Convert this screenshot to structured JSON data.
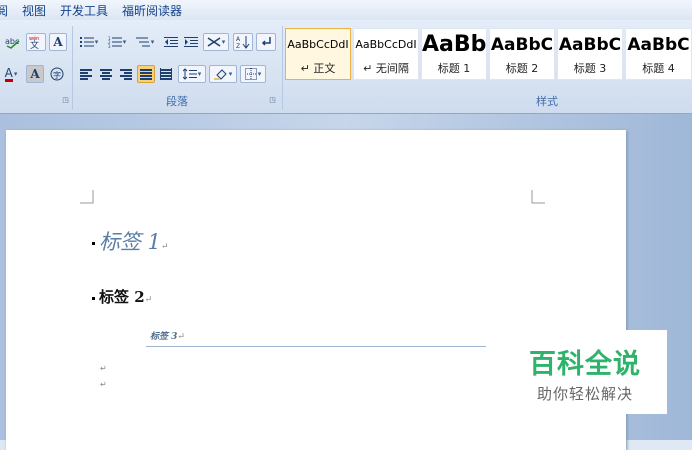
{
  "menu": {
    "items": [
      "阅",
      "视图",
      "开发工具",
      "福昕阅读器"
    ]
  },
  "ribbon": {
    "groups": {
      "paragraph_label": "段落",
      "styles_label": "样式"
    },
    "styles": [
      {
        "sample": "AaBbCcDdI",
        "name": "↵ 正文",
        "selected": true
      },
      {
        "sample": "AaBbCcDdI",
        "name": "↵ 无间隔",
        "selected": false
      },
      {
        "sample": "AaBb",
        "name": "标题 1",
        "selected": false
      },
      {
        "sample": "AaBbC",
        "name": "标题 2",
        "selected": false
      },
      {
        "sample": "AaBbC",
        "name": "标题 3",
        "selected": false
      },
      {
        "sample": "AaBbC",
        "name": "标题 4",
        "selected": false
      }
    ],
    "accent": "#c00000"
  },
  "document": {
    "heading1": "标签 1",
    "heading2": "标签 2",
    "heading3": "标签 3",
    "para_mark": "↵"
  },
  "watermark": {
    "title": "百科全说",
    "subtitle": "助你轻松解决"
  }
}
